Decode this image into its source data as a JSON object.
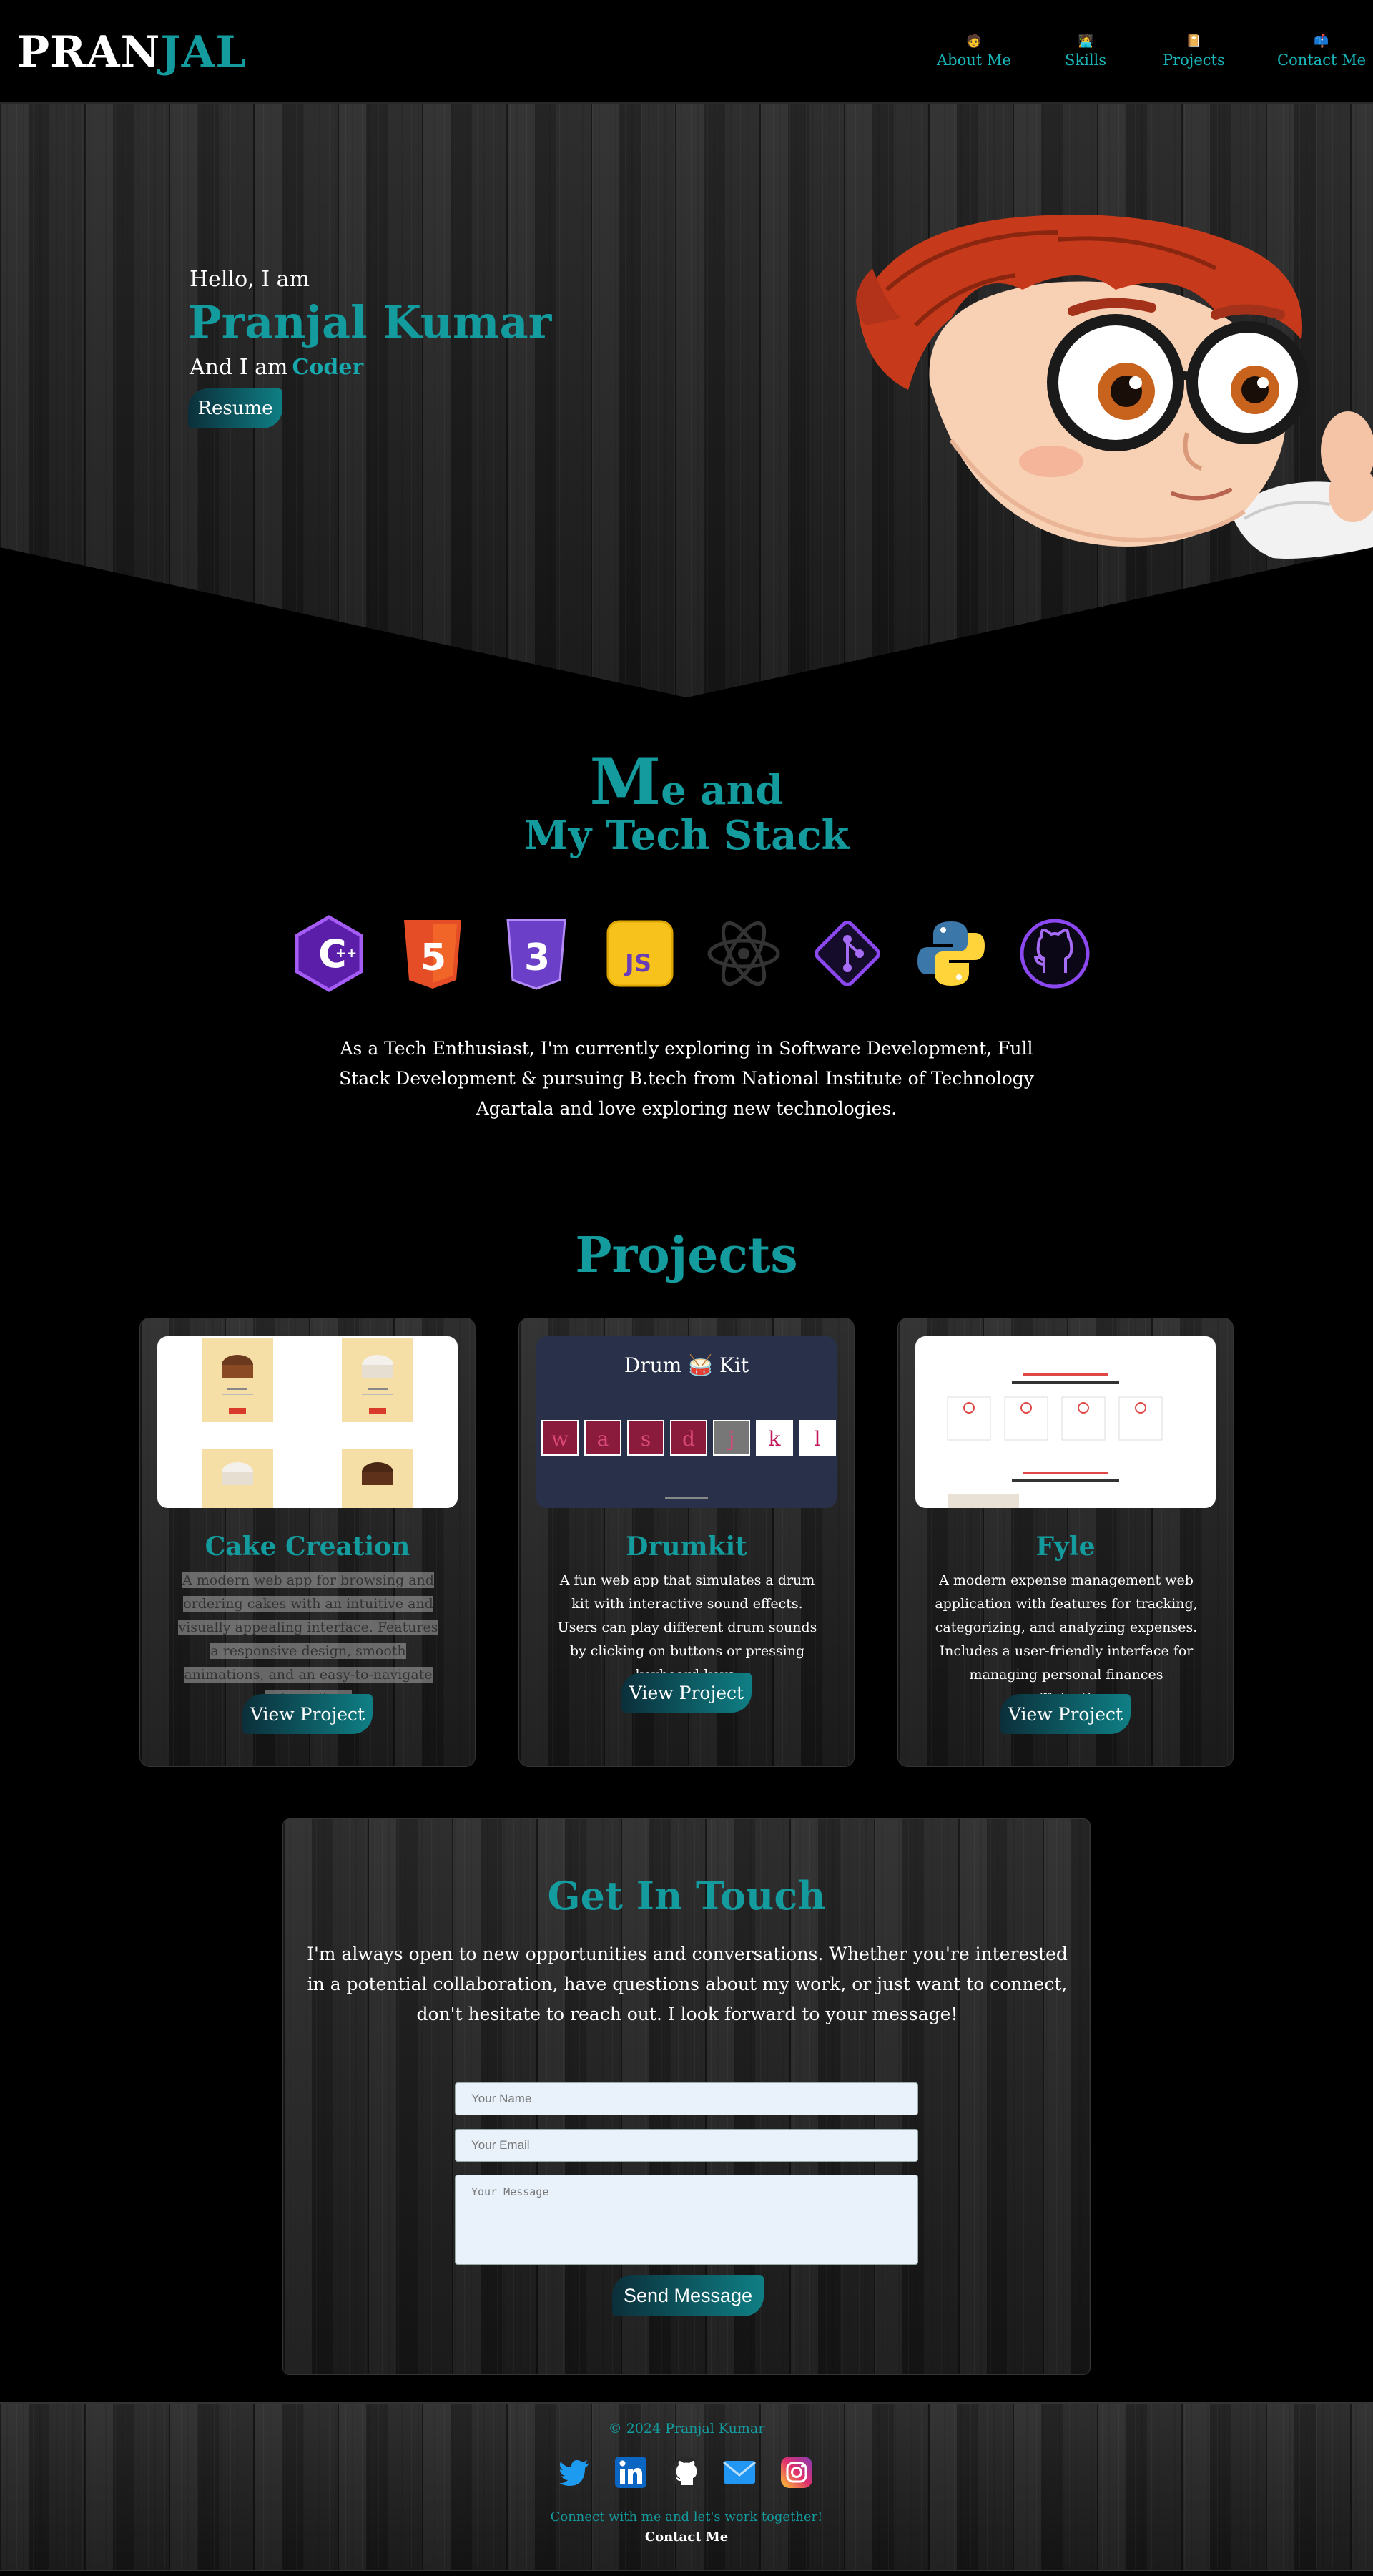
{
  "nav": {
    "logo_part1": "PRAN",
    "logo_part2": "JAL",
    "items": [
      {
        "label": "About Me",
        "icon": "person-emoji"
      },
      {
        "label": "Skills",
        "icon": "technologist-emoji"
      },
      {
        "label": "Projects",
        "icon": "notebook-emoji"
      },
      {
        "label": "Contact Me",
        "icon": "mailbox-emoji"
      }
    ]
  },
  "hero": {
    "greeting": "Hello, I am",
    "name": "Pranjal Kumar",
    "role_prefix": "And I am",
    "role": "Coder",
    "resume_label": "Resume"
  },
  "about": {
    "title_cap": "M",
    "title_rest": "e and",
    "title_line2": "My Tech Stack",
    "stack_icons": [
      "cpp-icon",
      "html5-icon",
      "css3-icon",
      "javascript-icon",
      "react-icon",
      "git-icon",
      "python-icon",
      "github-icon"
    ],
    "paragraph": "As a Tech Enthusiast, I'm currently exploring in Software Development, Full Stack Development & pursuing B.tech from National Institute of Technology Agartala and love exploring new technologies."
  },
  "projects": {
    "title": "Projects",
    "items": [
      {
        "title": "Cake Creation",
        "description": "A modern web app for browsing and ordering cakes with an intuitive and visually appealing interface. Features a responsive design, smooth animations, and an easy-to-navigate cake gallery.",
        "button": "View Project"
      },
      {
        "title": "Drumkit",
        "description": "A fun web app that simulates a drum kit with interactive sound effects. Users can play different drum sounds by clicking on buttons or pressing keyboard keys.",
        "button": "View Project",
        "preview_title": "Drum 🥁 Kit",
        "keys": [
          "w",
          "a",
          "s",
          "d",
          "j",
          "k",
          "l"
        ]
      },
      {
        "title": "Fyle",
        "description": "A modern expense management web application with features for tracking, categorizing, and analyzing expenses. Includes a user-friendly interface for managing personal finances efficiently.",
        "button": "View Project"
      }
    ]
  },
  "contact": {
    "title": "Get In Touch",
    "paragraph": "I'm always open to new opportunities and conversations. Whether you're interested in a potential collaboration, have questions about my work, or just want to connect, don't hesitate to reach out. I look forward to your message!",
    "name_placeholder": "Your Name",
    "email_placeholder": "Your Email",
    "message_placeholder": "Your Message",
    "send_label": "Send Message"
  },
  "footer": {
    "copyright": "© 2024 Pranjal Kumar",
    "socials": [
      "twitter-icon",
      "linkedin-icon",
      "github-icon",
      "email-icon",
      "instagram-icon"
    ],
    "tagline": "Connect with me and let's work together!",
    "contact_link": "Contact Me"
  },
  "colors": {
    "accent": "#139b9e",
    "background": "#000000",
    "field_bg": "#e9f1fb"
  }
}
